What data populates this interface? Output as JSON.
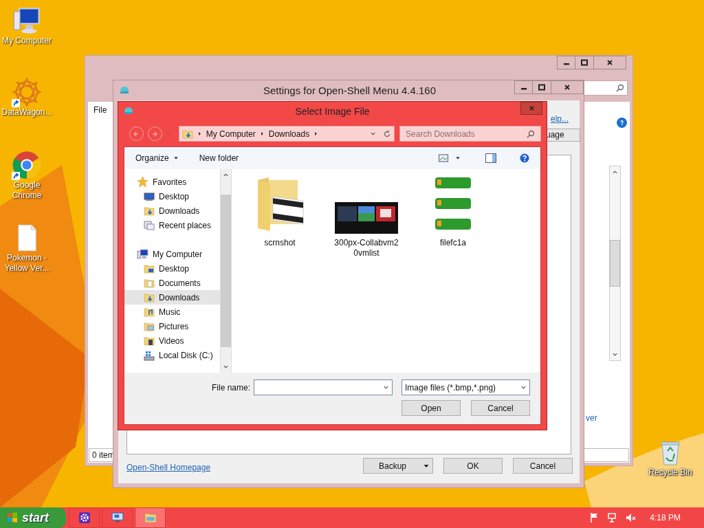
{
  "desktop_icons": [
    {
      "label": "My Computer",
      "kind": "computer",
      "shortcut": false
    },
    {
      "label": "DataWagon...",
      "kind": "mandala",
      "shortcut": true
    },
    {
      "label": "Google Chrome",
      "kind": "chrome",
      "shortcut": true
    },
    {
      "label": "Pokemon - Yellow Ver...",
      "kind": "document",
      "shortcut": false
    }
  ],
  "recycle_bin": {
    "label": "Recycle Bin"
  },
  "back_window": {
    "menu": [
      "File"
    ],
    "link_fragment": "ver",
    "status": "0 item"
  },
  "settings_window": {
    "title": "Settings for Open-Shell Menu 4.4.160",
    "help_link": "elp...",
    "column_header": "uage",
    "homepage_link": "Open-Shell Homepage",
    "buttons": [
      {
        "label": "Backup",
        "kind": "split"
      },
      {
        "label": "OK",
        "kind": "default"
      },
      {
        "label": "Cancel",
        "kind": "plain"
      }
    ]
  },
  "dialog": {
    "title": "Select Image File",
    "breadcrumb": [
      "My Computer",
      "Downloads"
    ],
    "search_placeholder": "Search Downloads",
    "toolbar": [
      "Organize",
      "New folder"
    ],
    "nav": [
      {
        "label": "Favorites",
        "kind": "star",
        "selected": false,
        "children": [
          {
            "label": "Desktop",
            "kind": "desktop",
            "selected": false
          },
          {
            "label": "Downloads",
            "kind": "downloads",
            "selected": false
          },
          {
            "label": "Recent places",
            "kind": "recent",
            "selected": false
          }
        ]
      },
      {
        "label": "My Computer",
        "kind": "computer",
        "selected": false,
        "children": [
          {
            "label": "Desktop",
            "kind": "folder-desktop",
            "selected": false
          },
          {
            "label": "Documents",
            "kind": "documents",
            "selected": false
          },
          {
            "label": "Downloads",
            "kind": "downloads",
            "selected": true
          },
          {
            "label": "Music",
            "kind": "music",
            "selected": false
          },
          {
            "label": "Pictures",
            "kind": "pictures",
            "selected": false
          },
          {
            "label": "Videos",
            "kind": "videos",
            "selected": false
          },
          {
            "label": "Local Disk (C:)",
            "kind": "disk",
            "selected": false
          }
        ]
      }
    ],
    "files": [
      {
        "name": "scrnshot",
        "kind": "folder"
      },
      {
        "name": "300px-Collabvm20vmlist",
        "kind": "screens"
      },
      {
        "name": "filefc1a",
        "kind": "buttons"
      }
    ],
    "file_name_label": "File name:",
    "file_type": "Image files (*.bmp,*.png)",
    "buttons": [
      "Open",
      "Cancel"
    ]
  },
  "taskbar": {
    "start": "start",
    "apps": [
      {
        "kind": "gear",
        "selected": false
      },
      {
        "kind": "monitor",
        "selected": false
      },
      {
        "kind": "folder",
        "selected": true
      }
    ],
    "clock": "4:18 PM"
  }
}
